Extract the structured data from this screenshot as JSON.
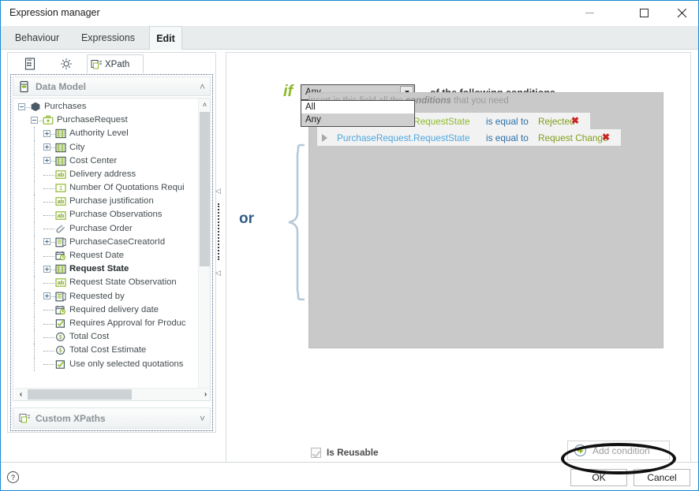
{
  "window": {
    "title": "Expression manager",
    "controls": {
      "minimize": "minimize-icon",
      "maximize": "maximize-icon",
      "close": "close-icon"
    }
  },
  "tabs": [
    {
      "label": "Behaviour",
      "active": false
    },
    {
      "label": "Expressions",
      "active": false
    },
    {
      "label": "Edit",
      "active": true
    }
  ],
  "left_panel": {
    "toolbar": [
      {
        "name": "document-icon",
        "label": ""
      },
      {
        "name": "gear-icon",
        "label": ""
      },
      {
        "name": "xpath-tab",
        "label": "XPath"
      }
    ],
    "data_model": {
      "header": "Data Model",
      "collapse_chevron": "˄",
      "tree": [
        {
          "label": "Purchases",
          "depth": 0,
          "icon": "hexagon-icon",
          "expander": "minus",
          "bold": false
        },
        {
          "label": "PurchaseRequest",
          "depth": 1,
          "icon": "briefcase-icon",
          "expander": "minus",
          "bold": false
        },
        {
          "label": "Authority Level",
          "depth": 2,
          "icon": "list-icon",
          "expander": "plus",
          "bold": false
        },
        {
          "label": "City",
          "depth": 2,
          "icon": "list-icon",
          "expander": "plus",
          "bold": false
        },
        {
          "label": "Cost Center",
          "depth": 2,
          "icon": "list-icon",
          "expander": "plus",
          "bold": false
        },
        {
          "label": "Delivery address",
          "depth": 2,
          "icon": "ab-text-icon",
          "expander": "none",
          "bold": false
        },
        {
          "label": "Number Of Quotations Requi",
          "depth": 2,
          "icon": "number-icon",
          "expander": "none",
          "bold": false
        },
        {
          "label": "Purchase justification",
          "depth": 2,
          "icon": "ab-text-icon",
          "expander": "none",
          "bold": false
        },
        {
          "label": "Purchase Observations",
          "depth": 2,
          "icon": "ab-text-icon",
          "expander": "none",
          "bold": false
        },
        {
          "label": "Purchase Order",
          "depth": 2,
          "icon": "paperclip-icon",
          "expander": "none",
          "bold": false
        },
        {
          "label": "PurchaseCaseCreatorId",
          "depth": 2,
          "icon": "record-icon",
          "expander": "plus",
          "bold": false
        },
        {
          "label": "Request Date",
          "depth": 2,
          "icon": "calendar-clock-icon",
          "expander": "none",
          "bold": false
        },
        {
          "label": "Request State",
          "depth": 2,
          "icon": "list-icon",
          "expander": "plus",
          "bold": true
        },
        {
          "label": "Request State Observation",
          "depth": 2,
          "icon": "ab-text-icon",
          "expander": "none",
          "bold": false
        },
        {
          "label": "Requested by",
          "depth": 2,
          "icon": "record-icon",
          "expander": "plus",
          "bold": false
        },
        {
          "label": "Required delivery date",
          "depth": 2,
          "icon": "calendar-clock-icon",
          "expander": "none",
          "bold": false
        },
        {
          "label": "Requires Approval for Produc",
          "depth": 2,
          "icon": "checkbox-icon",
          "expander": "none",
          "bold": false
        },
        {
          "label": "Total Cost",
          "depth": 2,
          "icon": "currency-icon",
          "expander": "none",
          "bold": false
        },
        {
          "label": "Total Cost Estimate",
          "depth": 2,
          "icon": "currency-icon",
          "expander": "none",
          "bold": false
        },
        {
          "label": "Use only selected quotations",
          "depth": 2,
          "icon": "checkbox-icon",
          "expander": "none",
          "bold": false
        }
      ],
      "scroll_up": "˄",
      "scroll_down": "˅",
      "scroll_left": "‹",
      "scroll_right": "›"
    },
    "custom_xpaths": {
      "header": "Custom XPaths",
      "expand_chevron": "˅"
    }
  },
  "splitter": {
    "arrow_top": "◁",
    "arrow_bottom": "◁"
  },
  "editor": {
    "if_label": "if",
    "match_combo": {
      "value": "Any",
      "options": [
        "All",
        "Any"
      ],
      "selected": "Any"
    },
    "following_text": "of the following conditions",
    "or_label": "or",
    "hint_prefix": "insert in this field all the",
    "hint_emphasis": "conditions",
    "hint_suffix": "that you need",
    "conditions": [
      {
        "field": "PurchaseRequest.RequestState",
        "field_color": "green",
        "operator": "is equal to",
        "value": "Rejected",
        "delete": "✖",
        "expand": "▶"
      },
      {
        "field": "PurchaseRequest.RequestState",
        "field_color": "blue",
        "operator": "is equal to",
        "value": "Request Change",
        "delete": "✖",
        "expand": "▶"
      }
    ],
    "is_reusable": {
      "label": "Is Reusable",
      "checked": true
    },
    "add_condition": {
      "label": "Add condition",
      "icon": "plus-circle-icon",
      "highlighted": true
    }
  },
  "footer": {
    "help": "?",
    "ok": "OK",
    "cancel": "Cancel"
  },
  "colors": {
    "accent_blue": "#1a8ad4",
    "green": "#8cb92a",
    "light_blue": "#4da6e0",
    "operator_blue": "#2b6fa5",
    "value_green": "#7f9d1f",
    "delete_red": "#cc2222",
    "panel_gray": "#c9c9c9"
  }
}
